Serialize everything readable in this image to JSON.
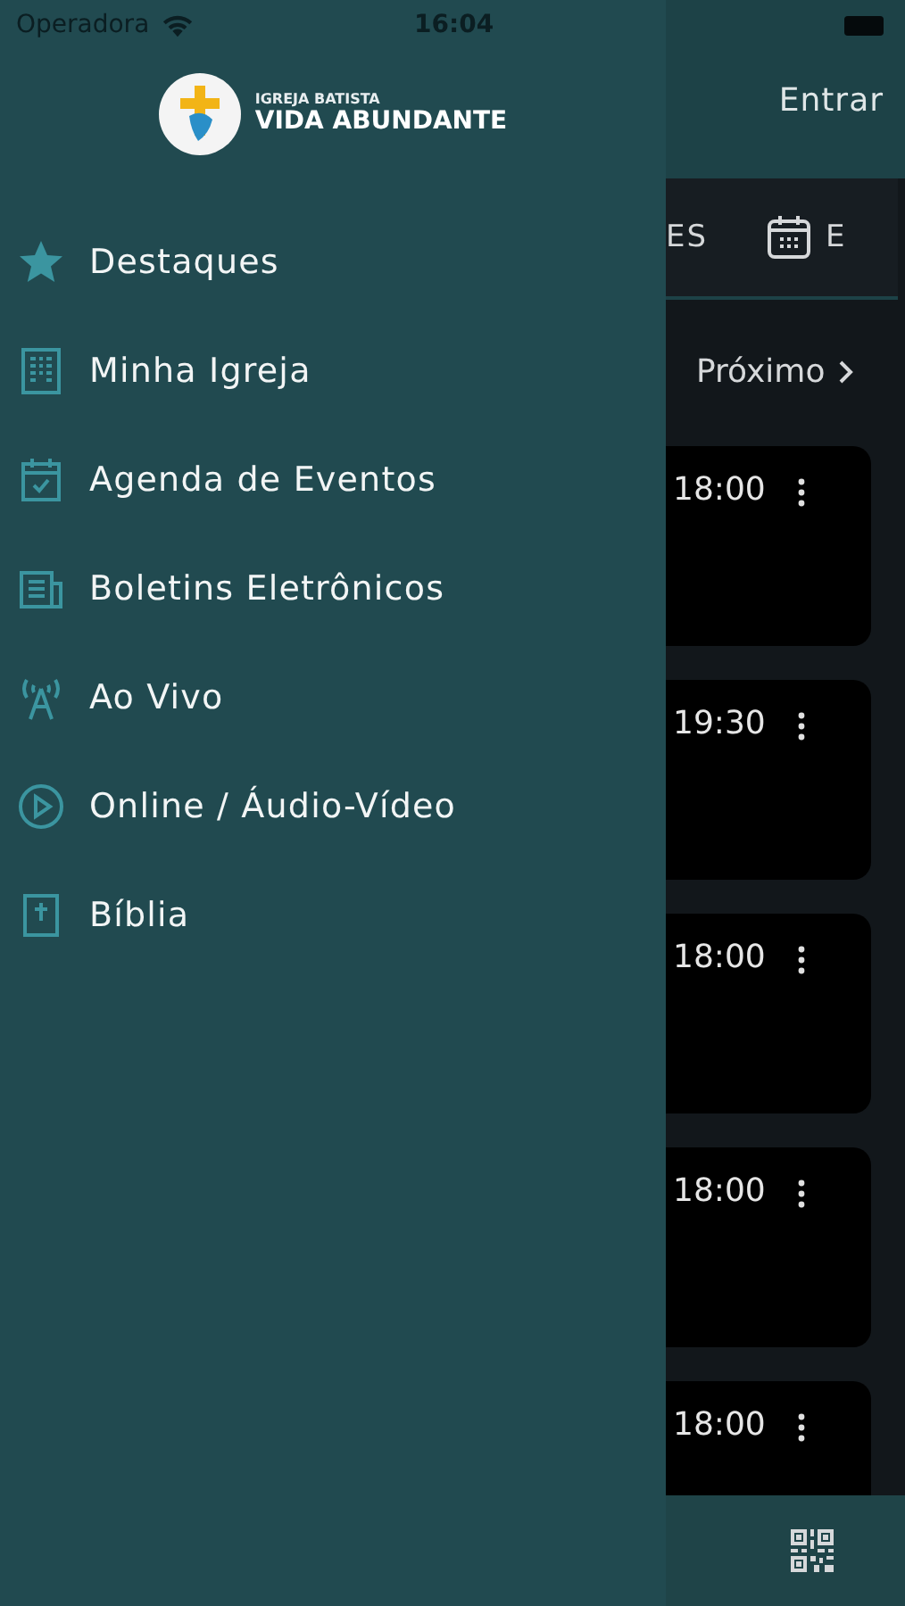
{
  "status_bar": {
    "carrier": "Operadora",
    "time": "16:04"
  },
  "drawer": {
    "logo": {
      "line_1": "IGREJA BATISTA",
      "line_2": "VIDA ABUNDANTE"
    },
    "items": [
      {
        "label": "Destaques",
        "kind": "star"
      },
      {
        "label": "Minha Igreja",
        "kind": "building"
      },
      {
        "label": "Agenda de Eventos",
        "kind": "calendar"
      },
      {
        "label": "Boletins Eletrônicos",
        "kind": "newspaper"
      },
      {
        "label": "Ao Vivo",
        "kind": "antenna"
      },
      {
        "label": "Online / Áudio-Vídeo",
        "kind": "play"
      },
      {
        "label": "Bíblia",
        "kind": "bible"
      }
    ]
  },
  "background_screen": {
    "header": {
      "login": "Entrar"
    },
    "tabs": [
      "ES",
      "E"
    ],
    "next": "Próximo",
    "events": [
      {
        "time": "18:00"
      },
      {
        "time": "19:30"
      },
      {
        "time": "18:00"
      },
      {
        "time": "18:00"
      },
      {
        "time": "18:00"
      }
    ]
  }
}
